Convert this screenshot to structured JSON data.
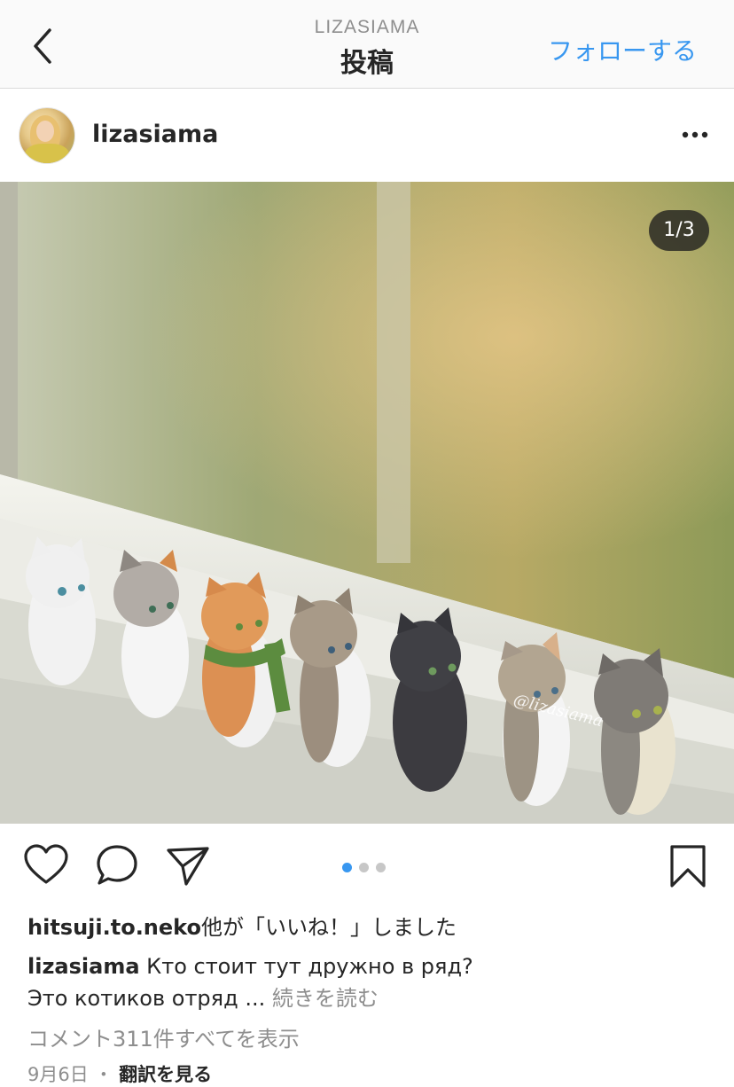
{
  "nav": {
    "account": "LIZASIAMA",
    "title": "投稿",
    "follow_label": "フォローする"
  },
  "post": {
    "username": "lizasiama",
    "image_counter": "1/3",
    "watermark": "@lizasiama",
    "carousel": {
      "count": 3,
      "active": 1
    }
  },
  "engagement": {
    "liked_by": "hitsuji.to.neko",
    "liked_suffix": "他が「いいね！」しました"
  },
  "caption": {
    "username": "lizasiama",
    "line1": "Кто стоит тут дружно в ряд?",
    "line2": "Это котиков отряд ...",
    "more_label": "続きを読む"
  },
  "comments_label": "コメント311件すべてを表示",
  "date": "9月6日",
  "translate_label": "翻訳を見る",
  "colors": {
    "accent": "#3897f0",
    "muted": "#8e8e8e",
    "text": "#262626"
  }
}
